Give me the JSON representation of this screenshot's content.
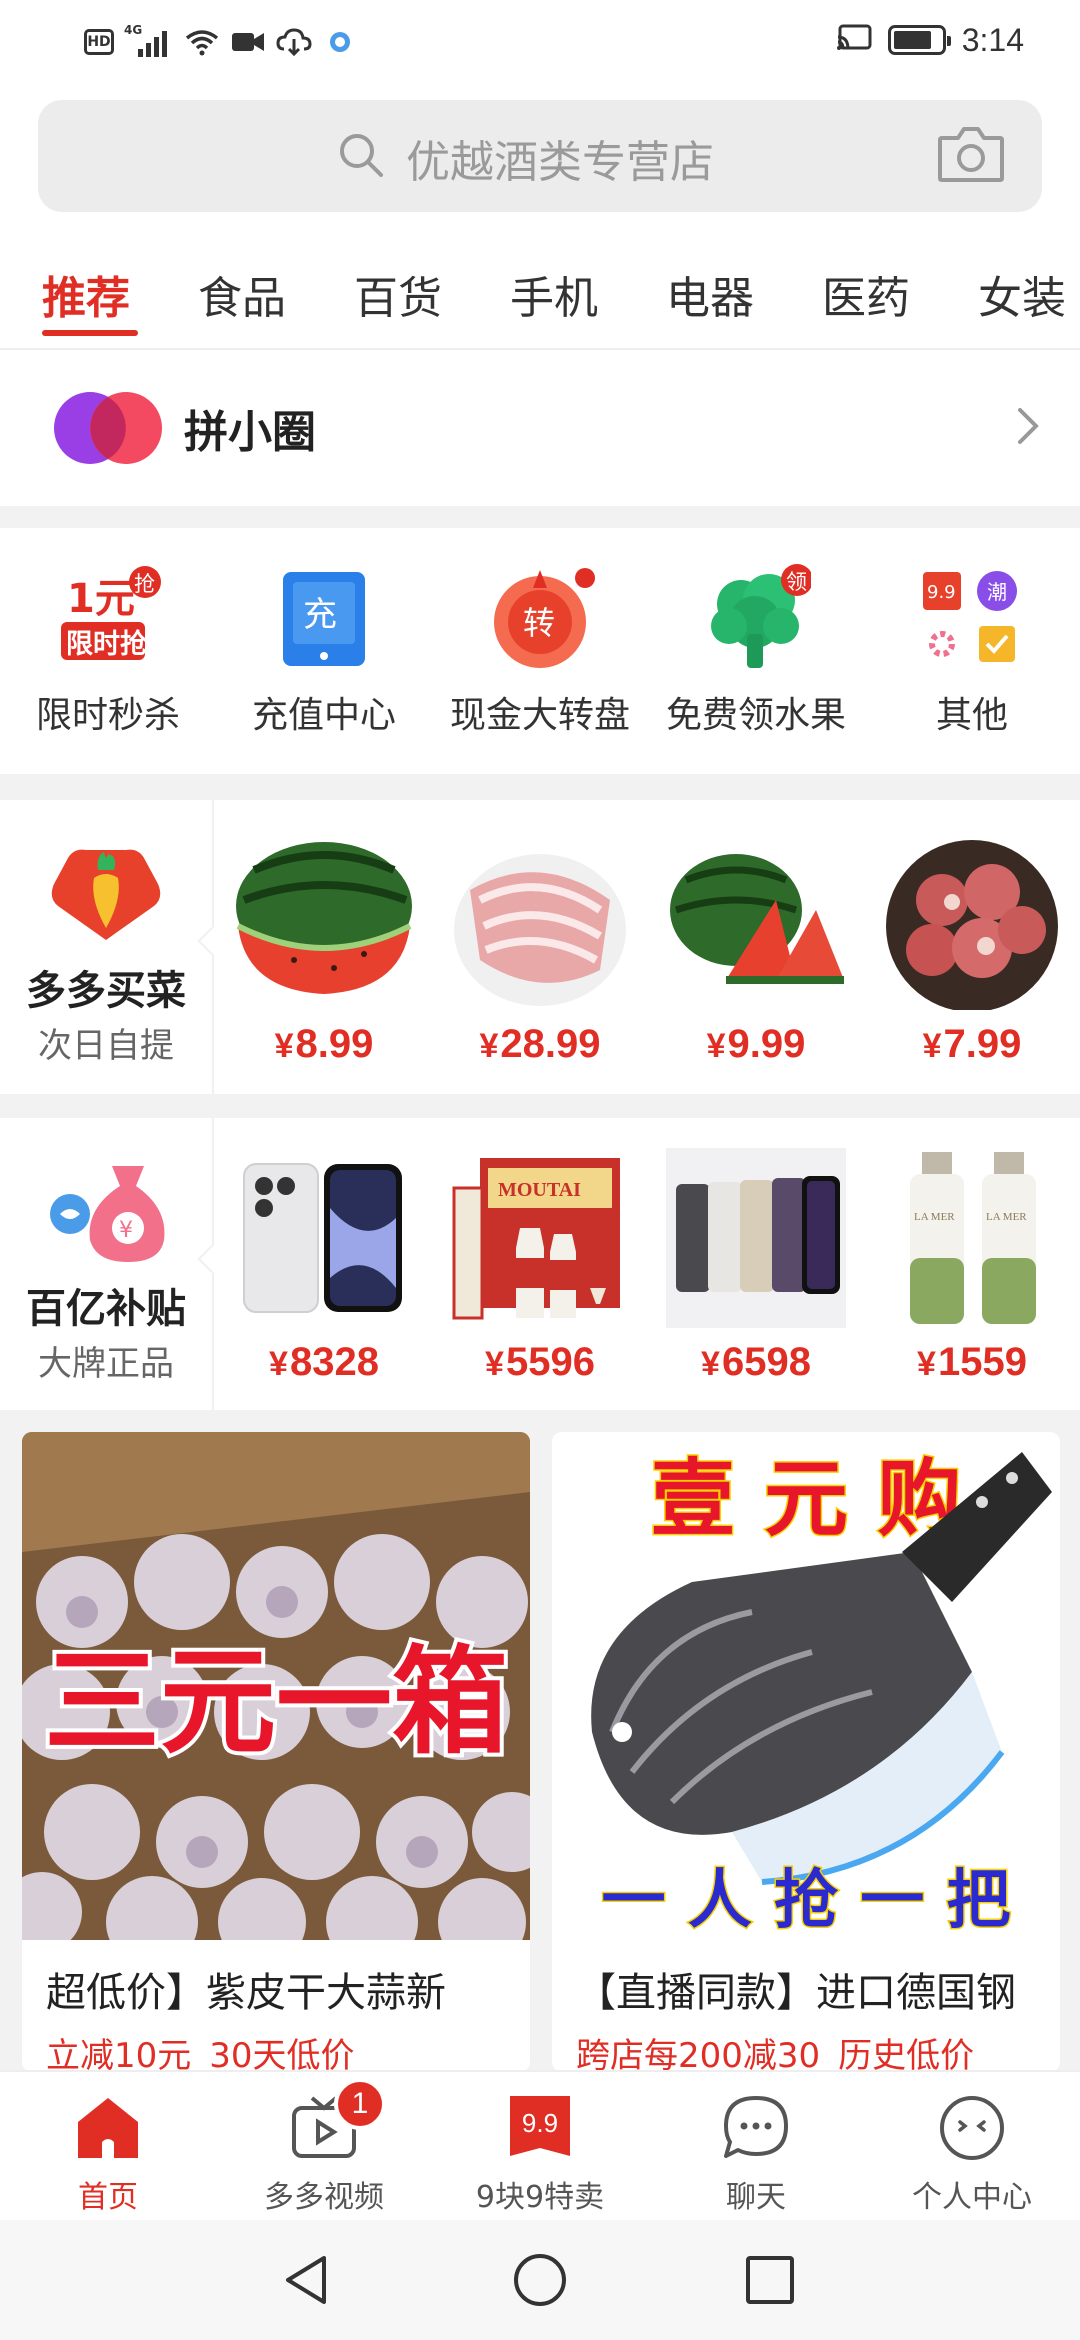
{
  "status_bar": {
    "hd": "HD",
    "network": "4G",
    "time": "3:14"
  },
  "search": {
    "placeholder": "优越酒类专营店"
  },
  "tabs": [
    {
      "label": "推荐",
      "active": true
    },
    {
      "label": "食品"
    },
    {
      "label": "百货"
    },
    {
      "label": "手机"
    },
    {
      "label": "电器"
    },
    {
      "label": "医药"
    },
    {
      "label": "女装"
    }
  ],
  "pin_circle": {
    "title": "拼小圈"
  },
  "shortcuts": [
    {
      "label": "限时秒杀",
      "icon": "flash-sale-icon",
      "icon_text_top": "1元",
      "icon_text_bottom": "限时抢",
      "badge": "抢"
    },
    {
      "label": "充值中心",
      "icon": "recharge-icon",
      "icon_text": "充"
    },
    {
      "label": "现金大转盘",
      "icon": "wheel-icon",
      "icon_text": "转"
    },
    {
      "label": "免费领水果",
      "icon": "tree-icon",
      "badge": "领"
    },
    {
      "label": "其他",
      "icon": "more-grid-icon",
      "icon_text_a": "9.9",
      "icon_text_b": "潮"
    }
  ],
  "grocery": {
    "title": "多多买菜",
    "subtitle": "次日自提",
    "items": [
      {
        "price": "8.99",
        "image": "watermelon-half"
      },
      {
        "price": "28.99",
        "image": "pork-ribs"
      },
      {
        "price": "9.99",
        "image": "watermelon-slices"
      },
      {
        "price": "7.99",
        "image": "pork-chunks"
      }
    ]
  },
  "subsidy": {
    "title": "百亿补贴",
    "subtitle": "大牌正品",
    "items": [
      {
        "price": "8328",
        "image": "iphone-white"
      },
      {
        "price": "5596",
        "image": "moutai",
        "brand_text": "MOUTAI"
      },
      {
        "price": "6598",
        "image": "iphone-colors"
      },
      {
        "price": "1559",
        "image": "la-mer-bottles",
        "brand_text": "LA MER"
      }
    ]
  },
  "currency": "¥",
  "feed": [
    {
      "title": "超低价】紫皮干大蒜新",
      "overlay": "三元一箱",
      "tags": [
        "立减10元",
        "30天低价"
      ]
    },
    {
      "title": "【直播同款】进口德国钢",
      "overlay_top": "壹 元 购",
      "overlay_bottom": "一 人 抢 一 把",
      "tags": [
        "跨店每200减30",
        "历史低价"
      ]
    }
  ],
  "bottom_nav": [
    {
      "label": "首页",
      "icon": "home-icon",
      "active": true
    },
    {
      "label": "多多视频",
      "icon": "video-icon",
      "badge": "1"
    },
    {
      "label": "9块9特卖",
      "icon": "sale-99-icon",
      "icon_text": "9.9"
    },
    {
      "label": "聊天",
      "icon": "chat-icon"
    },
    {
      "label": "个人中心",
      "icon": "profile-icon"
    }
  ],
  "colors": {
    "accent": "#e02e24",
    "background_gray": "#f2f2f2"
  }
}
